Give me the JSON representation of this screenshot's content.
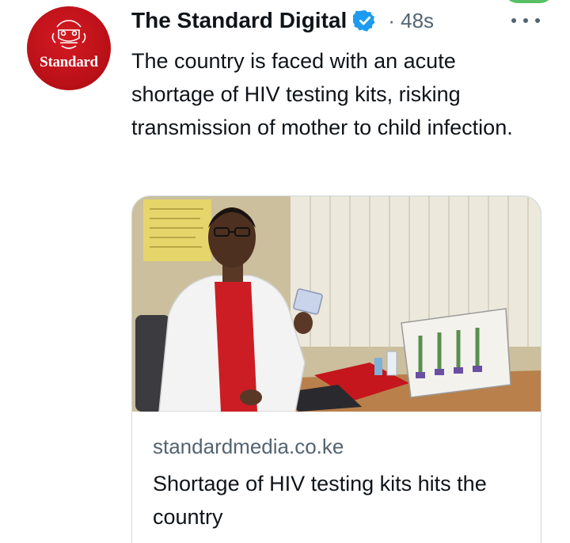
{
  "tweet": {
    "author": {
      "name": "The Standard Digital",
      "avatar_label": "Standard",
      "avatar_color": "#c0121a",
      "verified": true,
      "verified_icon": "verified-badge-icon",
      "verified_color": "#1d9bf0"
    },
    "timestamp": "· 48s",
    "more_icon": "more-options-icon",
    "text": "The country is faced with an acute shortage of HIV testing kits, risking transmission of mother to child infection."
  },
  "link_card": {
    "domain": "standardmedia.co.ke",
    "title": "Shortage of HIV testing kits hits the country"
  },
  "colors": {
    "text_primary": "#0f1419",
    "text_secondary": "#536471",
    "card_border": "#cfd9de"
  }
}
